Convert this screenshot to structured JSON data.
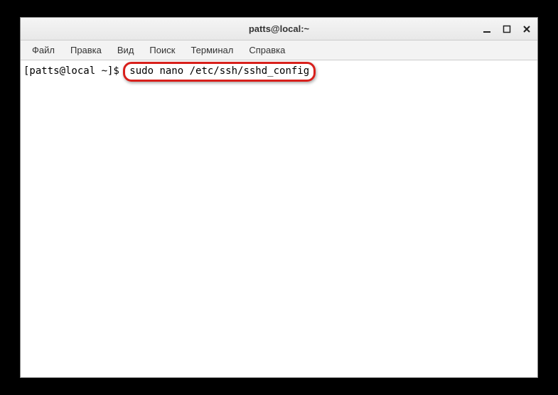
{
  "window": {
    "title": "patts@local:~"
  },
  "menu": {
    "file": "Файл",
    "edit": "Правка",
    "view": "Вид",
    "search": "Поиск",
    "terminal": "Терминал",
    "help": "Справка"
  },
  "terminal": {
    "prompt": "[patts@local ~]$ ",
    "command": "sudo nano /etc/ssh/sshd_config"
  }
}
